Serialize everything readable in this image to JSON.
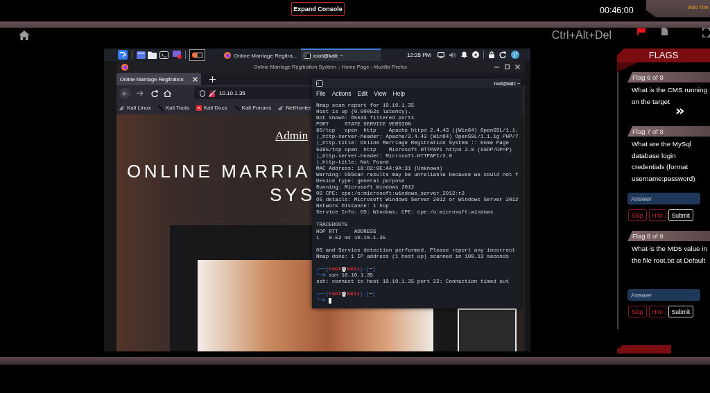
{
  "top_bar": {
    "expand_button": "Expand Console",
    "timer": "00:46:00",
    "add_time": "Add Tim"
  },
  "toolbar": {
    "shortcut": "Ctrl+Alt+Del"
  },
  "vm": {
    "taskbar": {
      "windows": [
        {
          "kind": "browser",
          "label": "Online Marriage Regitra…",
          "selected": false
        },
        {
          "kind": "terminal",
          "label": "root@kali: ~",
          "selected": true
        }
      ],
      "clock": "12:35 PM"
    },
    "browser": {
      "title": "Online Marriage Regitration System :: Home Page - Mozilla Firefox",
      "tabs": [
        {
          "label": "Online Marriage Regitration",
          "selected": true
        }
      ],
      "url": "10.10.1.35",
      "bookmarks": [
        {
          "kind": "logo",
          "label": "Kali Linux"
        },
        {
          "kind": "slash",
          "label": "Kali Tools"
        },
        {
          "kind": "docs",
          "label": "Kali Docs"
        },
        {
          "kind": "slash",
          "label": "Kali Forums"
        },
        {
          "kind": "logo",
          "label": "NetHunter"
        }
      ],
      "page": {
        "link": "Admin",
        "heading_lines": [
          "ONLINE MARRIA",
          "SYS"
        ]
      }
    },
    "terminal": {
      "title": "root@kali: ~",
      "menu": [
        "File",
        "Actions",
        "Edit",
        "View",
        "Help"
      ],
      "lines": [
        {
          "kind": "text",
          "text": "Nmap scan report for 10.10.1.35"
        },
        {
          "kind": "text",
          "text": "Host is up (0.00052s latency)."
        },
        {
          "kind": "text",
          "text": "Not shown: 65533 filtered ports"
        },
        {
          "kind": "text",
          "text": "PORT     STATE SERVICE VERSION"
        },
        {
          "kind": "text",
          "text": "80/tcp   open  http    Apache httpd 2.4.43 ((Win64) OpenSSL/1.1."
        },
        {
          "kind": "text",
          "text": "|_http-server-header: Apache/2.4.43 (Win64) OpenSSL/1.1.1g PHP/7"
        },
        {
          "kind": "text",
          "text": "|_http-title: Online Marriage Regitration System :: Home Page"
        },
        {
          "kind": "text",
          "text": "5985/tcp open  http    Microsoft HTTPAPI httpd 2.0 (SSDP/UPnP)"
        },
        {
          "kind": "text",
          "text": "|_http-server-header: Microsoft-HTTPAPI/2.0"
        },
        {
          "kind": "text",
          "text": "|_http-title: Not Found"
        },
        {
          "kind": "text",
          "text": "MAC Address: 18:D2:9E:A4:9A:31 (Unknown)"
        },
        {
          "kind": "text",
          "text": "Warning: OSScan results may be unreliable because we could not f"
        },
        {
          "kind": "text",
          "text": "Device type: general purpose"
        },
        {
          "kind": "text",
          "text": "Running: Microsoft Windows 2012"
        },
        {
          "kind": "text",
          "text": "OS CPE: cpe:/o:microsoft:windows_server_2012:r2"
        },
        {
          "kind": "text",
          "text": "OS details: Microsoft Windows Server 2012 or Windows Server 2012"
        },
        {
          "kind": "text",
          "text": "Network Distance: 1 hop"
        },
        {
          "kind": "text",
          "text": "Service Info: OS: Windows; CPE: cpe:/o:microsoft:windows"
        },
        {
          "kind": "blank"
        },
        {
          "kind": "text",
          "text": "TRACEROUTE"
        },
        {
          "kind": "text",
          "text": "HOP RTT     ADDRESS"
        },
        {
          "kind": "text",
          "text": "1   0.52 ms 10.10.1.35"
        },
        {
          "kind": "blank"
        },
        {
          "kind": "text",
          "text": "OS and Service detection performed. Please report any incorrect"
        },
        {
          "kind": "text",
          "text": "Nmap done: 1 IP address (1 host up) scanned in 109.13 seconds"
        },
        {
          "kind": "blank"
        },
        {
          "kind": "prompt",
          "frame": [
            "┌──(",
            ")-[",
            "]"
          ],
          "user": "root",
          "host": "kali",
          "dir": "~"
        },
        {
          "kind": "input",
          "mark": "└─#",
          "command": "ssh 10.10.1.35"
        },
        {
          "kind": "text",
          "text": "ssh: connect to host 10.10.1.35 port 22: Connection timed out"
        },
        {
          "kind": "blank"
        },
        {
          "kind": "prompt",
          "frame": [
            "┌──(",
            ")-[",
            "]"
          ],
          "user": "root",
          "host": "kali",
          "dir": "~"
        },
        {
          "kind": "input",
          "mark": "└─#",
          "cursor": true
        }
      ]
    }
  },
  "flags": {
    "title": "FLAGS",
    "items": [
      {
        "header": "Flag 6 of 8",
        "question": "What is the CMS running on the target",
        "expandable": true
      },
      {
        "header": "Flag 7 of 8",
        "question": "What are the MySql database login credentials (format username:password)",
        "expandable": false,
        "answer": {
          "placeholder": "Answer"
        },
        "buttons": [
          {
            "kind": "skip",
            "label": "Skip"
          },
          {
            "kind": "hint",
            "label": "Hint"
          },
          {
            "kind": "submit",
            "label": "Submit"
          }
        ]
      },
      {
        "header": "Flag 8 of 8",
        "question": "What is the MD5 value in the file root.txt at Default",
        "expandable": false,
        "answer": {
          "placeholder": "Answer"
        },
        "buttons": [
          {
            "kind": "skip",
            "label": "Skip"
          },
          {
            "kind": "hint",
            "label": "Hint"
          },
          {
            "kind": "submit",
            "label": "Submit"
          }
        ]
      }
    ]
  }
}
